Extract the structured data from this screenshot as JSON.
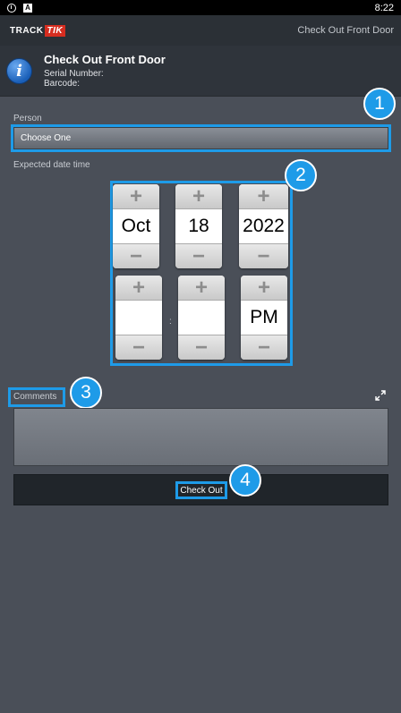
{
  "status_bar": {
    "time": "8:22",
    "icons": [
      "clock-icon",
      "a-icon"
    ]
  },
  "app_bar": {
    "logo_track": "TRACK",
    "logo_tik": "TIK",
    "title": "Check Out Front Door"
  },
  "header": {
    "icon": "info-icon",
    "title": "Check Out Front Door",
    "serial_label": "Serial Number:",
    "barcode_label": "Barcode:"
  },
  "form": {
    "person_label": "Person",
    "person_value": "Choose One",
    "expected_label": "Expected date time",
    "date": {
      "month": "Oct",
      "day": "18",
      "year": "2022"
    },
    "time": {
      "hour": "",
      "minute": "",
      "ampm": "PM",
      "separator": ":"
    },
    "comments_label": "Comments",
    "checkout_label": "Check Out"
  },
  "callouts": [
    "1",
    "2",
    "3",
    "4"
  ],
  "colors": {
    "highlight": "#1e9be8",
    "background": "#4a4f58",
    "brand_red": "#d62d20"
  }
}
